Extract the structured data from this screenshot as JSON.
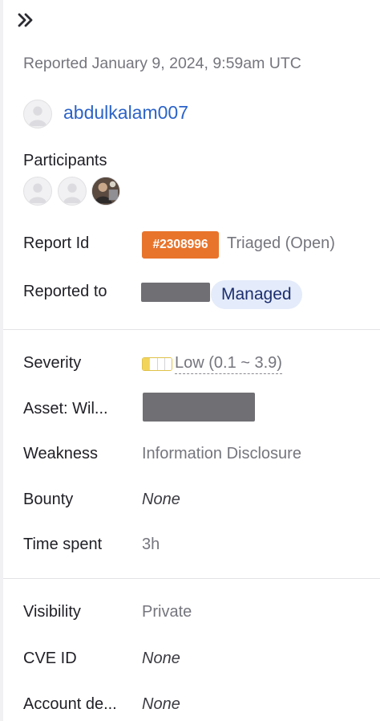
{
  "reported": "Reported January 9, 2024, 9:59am UTC",
  "reporter": {
    "username": "abdulkalam007"
  },
  "participants": {
    "label": "Participants"
  },
  "report_id": {
    "label": "Report Id",
    "id": "#2308996",
    "status": "Triaged (Open)"
  },
  "reported_to": {
    "label": "Reported to",
    "program_type": "Managed"
  },
  "severity": {
    "label": "Severity",
    "value": "Low (0.1 ~ 3.9)",
    "level_filled": 1,
    "level_total": 4,
    "meter_color": "#f3d45a"
  },
  "asset": {
    "label": "Asset: Wil..."
  },
  "weakness": {
    "label": "Weakness",
    "value": "Information Disclosure"
  },
  "bounty": {
    "label": "Bounty",
    "value": "None"
  },
  "time_spent": {
    "label": "Time spent",
    "value": "3h"
  },
  "visibility": {
    "label": "Visibility",
    "value": "Private"
  },
  "cve_id": {
    "label": "CVE ID",
    "value": "None"
  },
  "account_details": {
    "label": "Account de...",
    "value": "None"
  },
  "colors": {
    "link": "#2b63c9",
    "badge": "#e8742b",
    "pill_bg": "#e4ebfa",
    "pill_text": "#1c2e6e",
    "muted_text": "#75757e"
  },
  "icons": {
    "collapse": "double-chevron-right-icon",
    "avatar": "user-avatar-icon"
  }
}
